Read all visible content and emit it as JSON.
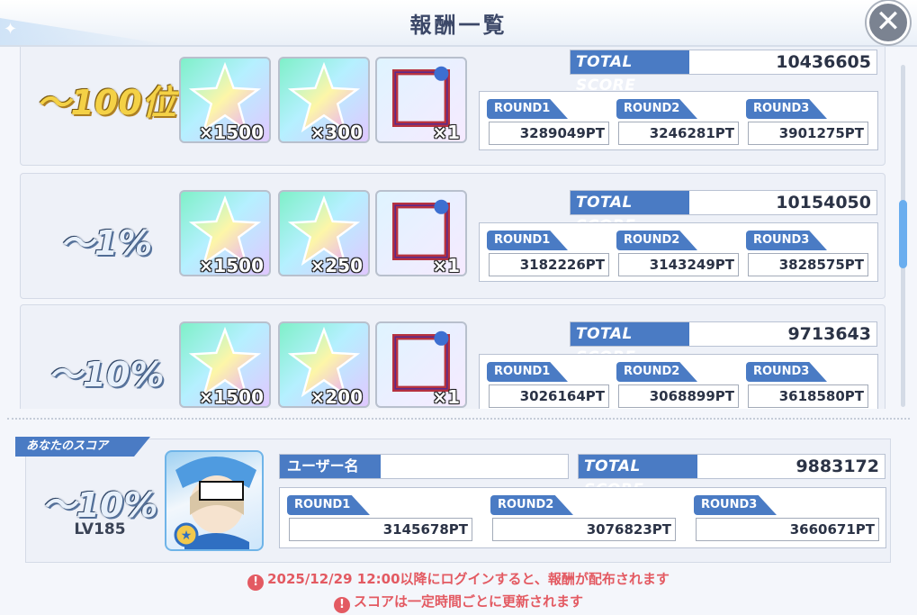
{
  "header": {
    "title": "報酬一覧"
  },
  "reward_rows": [
    {
      "rank": "〜100位",
      "rewards": [
        {
          "icon": "rainbow-star-icon",
          "qty": "×1500"
        },
        {
          "icon": "rainbow-star-icon",
          "qty": "×300"
        },
        {
          "icon": "frame-icon",
          "qty": "×1"
        }
      ],
      "total_score_label": "TOTAL SCORE",
      "total_score": "10436605",
      "rounds": [
        {
          "label": "ROUND1",
          "value": "3289049PT"
        },
        {
          "label": "ROUND2",
          "value": "3246281PT"
        },
        {
          "label": "ROUND3",
          "value": "3901275PT"
        }
      ]
    },
    {
      "rank": "〜1%",
      "rewards": [
        {
          "icon": "rainbow-star-icon",
          "qty": "×1500"
        },
        {
          "icon": "rainbow-star-icon",
          "qty": "×250"
        },
        {
          "icon": "frame-icon",
          "qty": "×1"
        }
      ],
      "total_score_label": "TOTAL SCORE",
      "total_score": "10154050",
      "rounds": [
        {
          "label": "ROUND1",
          "value": "3182226PT"
        },
        {
          "label": "ROUND2",
          "value": "3143249PT"
        },
        {
          "label": "ROUND3",
          "value": "3828575PT"
        }
      ]
    },
    {
      "rank": "〜10%",
      "rewards": [
        {
          "icon": "rainbow-star-icon",
          "qty": "×1500"
        },
        {
          "icon": "rainbow-star-icon",
          "qty": "×200"
        },
        {
          "icon": "frame-icon",
          "qty": "×1"
        }
      ],
      "total_score_label": "TOTAL SCORE",
      "total_score": "9713643",
      "rounds": [
        {
          "label": "ROUND1",
          "value": "3026164PT"
        },
        {
          "label": "ROUND2",
          "value": "3068899PT"
        },
        {
          "label": "ROUND3",
          "value": "3618580PT"
        }
      ]
    }
  ],
  "my_score": {
    "tag": "あなたのスコア",
    "rank": "〜10%",
    "level": "LV185",
    "user_name_label": "ユーザー名",
    "total_score_label": "TOTAL SCORE",
    "total_score": "9883172",
    "rounds": [
      {
        "label": "ROUND1",
        "value": "3145678PT"
      },
      {
        "label": "ROUND2",
        "value": "3076823PT"
      },
      {
        "label": "ROUND3",
        "value": "3660671PT"
      }
    ]
  },
  "notices": [
    "2025/12/29 12:00以降にログインすると、報酬が配布されます",
    "スコアは一定時間ごとに更新されます"
  ],
  "colors": {
    "accent": "#4a7bc4",
    "warning": "#e35a62",
    "gold": "#f4d146"
  }
}
